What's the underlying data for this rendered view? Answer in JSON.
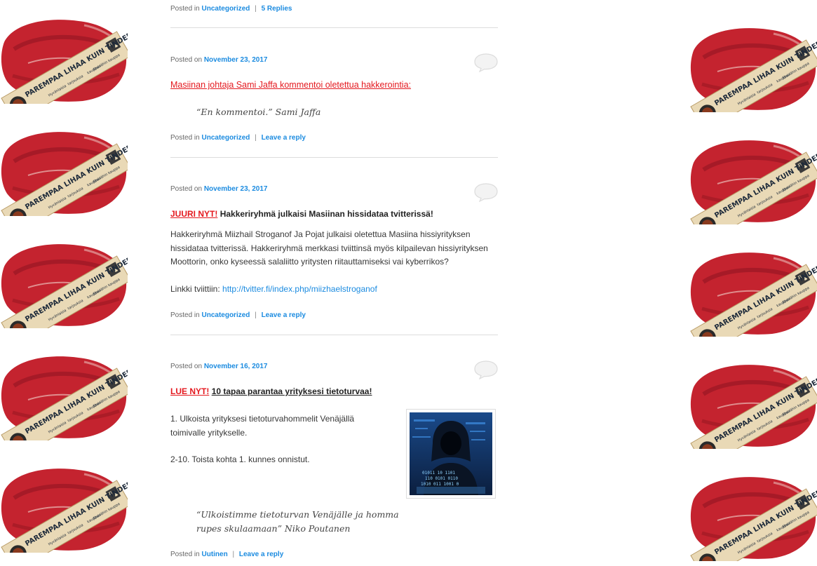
{
  "ad_banner": {
    "headline": "PAREMPAA LIHAA KUIN TINDERISSÄ",
    "small_lines": [
      "Hyvänlaisia",
      "tarjouksia",
      "kauppaa"
    ],
    "sticker_right": "Etsi lähin kauppa",
    "colors": {
      "meat": "#c4232f",
      "meat_dark": "#8e1420",
      "fat": "#f2d6cf",
      "banner": "#e9d9b6",
      "banner_text": "#1d2a3a"
    }
  },
  "posts": [
    {
      "meta_bottom": {
        "posted_in": "Posted in",
        "category": "Uncategorized",
        "separator": "|",
        "reply": "5 Replies"
      }
    },
    {
      "meta_top": {
        "posted_on": "Posted on",
        "date": "November 23, 2017"
      },
      "link_text": "Masiinan johtaja Sami Jaffa kommentoi oletettua hakkerointia:",
      "quote": "“En kommentoi.” Sami Jaffa",
      "meta_bottom": {
        "posted_in": "Posted in",
        "category": "Uncategorized",
        "separator": "|",
        "reply": "Leave a reply"
      }
    },
    {
      "meta_top": {
        "posted_on": "Posted on",
        "date": "November 23, 2017"
      },
      "title_hot": "JUURI NYT!",
      "title_rest": "Hakkeriryhmä julkaisi Masiinan hissidataa tvitterissä!",
      "body_lines": [
        "Hakkeriryhmä Miizhail Stroganof Ja Pojat julkaisi oletettua Masiina hissiyrityksen",
        "hissidataa tvitterissä. Hakkeriryhmä merkkasi tviittinsä myös kilpailevan hissiyrityksen",
        "Moottorin, onko kyseessä salaliitto yritysten riitauttamiseksi vai kyberrikos?"
      ],
      "link_label": "Linkki tviittiin:",
      "link_url": "http://tvitter.fi/index.php/miizhaelstroganof",
      "meta_bottom": {
        "posted_in": "Posted in",
        "category": "Uncategorized",
        "separator": "|",
        "reply": "Leave a reply"
      }
    },
    {
      "meta_top": {
        "posted_on": "Posted on",
        "date": "November 16, 2017"
      },
      "title_hot": "LUE NYT!",
      "title_rest": "10 tapaa parantaa yrityksesi tietoturvaa!",
      "body_line1": "1. Ulkoista yrityksesi tietoturvahommelit Venäjällä",
      "body_line2": "toimivalle yritykselle.",
      "body_line3": "2-10. Toista kohta 1. kunnes onnistut.",
      "quote_line1": "“Ulkoistimme tietoturvan Venäjälle ja homma",
      "quote_line2": "rupes skulaamaan” Niko Poutanen",
      "meta_bottom": {
        "posted_in": "Posted in",
        "category": "Uutinen",
        "separator": "|",
        "reply": "Leave a reply"
      }
    }
  ]
}
